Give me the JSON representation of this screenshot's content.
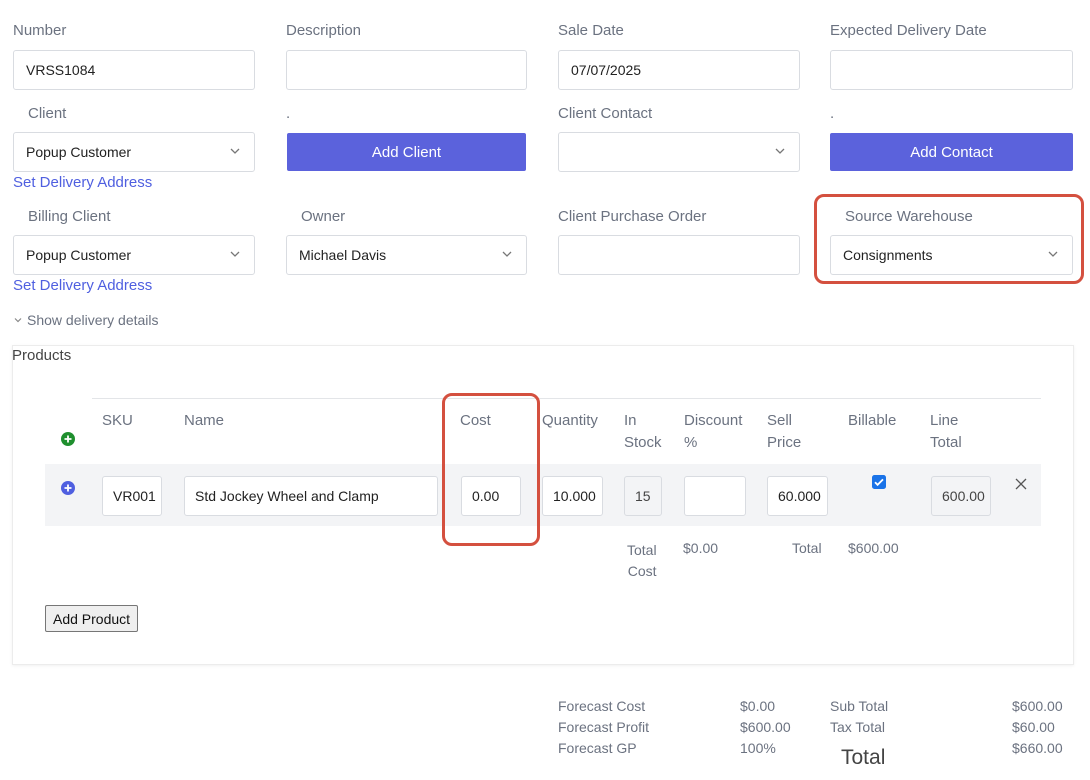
{
  "form": {
    "number": {
      "label": "Number",
      "value": "VRSS1084"
    },
    "description": {
      "label": "Description",
      "value": ""
    },
    "sale_date": {
      "label": "Sale Date",
      "value": "07/07/2025"
    },
    "expected_delivery_date": {
      "label": "Expected Delivery Date",
      "value": ""
    },
    "client": {
      "label": "Client",
      "value": "Popup Customer"
    },
    "dot1": ".",
    "add_client_label": "Add Client",
    "client_contact": {
      "label": "Client Contact",
      "value": ""
    },
    "dot2": ".",
    "add_contact_label": "Add Contact",
    "set_delivery_address_1": "Set Delivery Address",
    "billing_client": {
      "label": "Billing Client",
      "value": "Popup Customer"
    },
    "owner": {
      "label": "Owner",
      "value": "Michael Davis"
    },
    "client_purchase_order": {
      "label": "Client Purchase Order",
      "value": ""
    },
    "source_warehouse": {
      "label": "Source Warehouse",
      "value": "Consignments"
    },
    "set_delivery_address_2": "Set Delivery Address",
    "show_delivery_details": "Show delivery details"
  },
  "products": {
    "section_title": "Products",
    "headers": {
      "sku": "SKU",
      "name": "Name",
      "cost": "Cost",
      "quantity": "Quantity",
      "in_stock_1": "In",
      "in_stock_2": "Stock",
      "discount_1": "Discount",
      "discount_2": "%",
      "sell_price_1": "Sell",
      "sell_price_2": "Price",
      "billable": "Billable",
      "line_total_1": "Line",
      "line_total_2": "Total"
    },
    "row": {
      "sku": "VR001",
      "name": "Std Jockey Wheel and Clamp",
      "cost": "0.00",
      "quantity": "10.000",
      "in_stock": "15",
      "discount": "",
      "sell_price": "60.000",
      "billable": true,
      "line_total": "600.00"
    },
    "totals": {
      "total_cost_label_1": "Total",
      "total_cost_label_2": "Cost",
      "total_cost_value": "$0.00",
      "total_label": "Total",
      "total_value": "$600.00"
    },
    "add_product_label": "Add Product"
  },
  "summary": {
    "forecast_cost_label": "Forecast Cost",
    "forecast_cost_value": "$0.00",
    "forecast_profit_label": "Forecast Profit",
    "forecast_profit_value": "$600.00",
    "forecast_gp_label": "Forecast GP",
    "forecast_gp_value": "100%",
    "sub_total_label": "Sub Total",
    "sub_total_value": "$600.00",
    "tax_total_label": "Tax Total",
    "tax_total_value": "$60.00",
    "total_label": "Total",
    "total_value": "$660.00"
  },
  "colors": {
    "primary_button": "#5b62dc",
    "link": "#4f5fe0",
    "highlight": "#d4503f",
    "add_row_icon": "#1f8f2e",
    "row_icon": "#4f5fe0"
  }
}
